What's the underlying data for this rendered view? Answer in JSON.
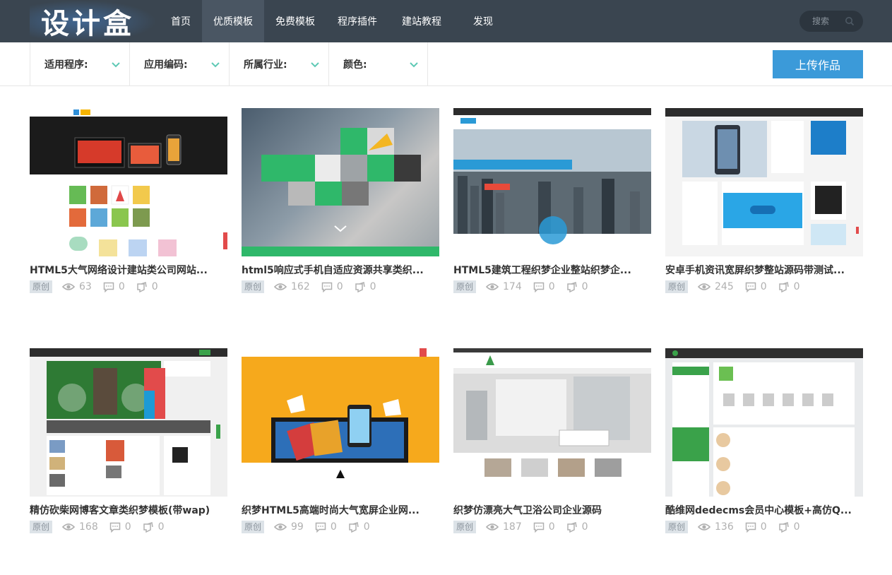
{
  "logo": {
    "text": "设计盒"
  },
  "nav": {
    "items": [
      {
        "label": "首页"
      },
      {
        "label": "优质模板"
      },
      {
        "label": "免费模板"
      },
      {
        "label": "程序插件"
      },
      {
        "label": "建站教程"
      },
      {
        "label": "发现"
      }
    ],
    "active_index": 1
  },
  "search": {
    "placeholder": "搜索",
    "icon": "search-icon"
  },
  "filters": [
    {
      "label": "适用程序:"
    },
    {
      "label": "应用编码:"
    },
    {
      "label": "所属行业:"
    },
    {
      "label": "颜色:"
    }
  ],
  "upload": {
    "label": "上传作品"
  },
  "colors": {
    "topbar": "#3a4550",
    "accent": "#3b9ad9",
    "chevron": "#5ec9b5"
  },
  "cards": [
    {
      "title": "HTML5大气网络设计建站类公司网站...",
      "badge": "原创",
      "views": "63",
      "comments": "0",
      "likes": "0"
    },
    {
      "title": "html5响应式手机自适应资源共享类织...",
      "badge": "原创",
      "views": "162",
      "comments": "0",
      "likes": "0"
    },
    {
      "title": "HTML5建筑工程织梦企业整站织梦企...",
      "badge": "原创",
      "views": "174",
      "comments": "0",
      "likes": "0"
    },
    {
      "title": "安卓手机资讯宽屏织梦整站源码带测试...",
      "badge": "原创",
      "views": "245",
      "comments": "0",
      "likes": "0"
    },
    {
      "title": "精仿砍柴网博客文章类织梦模板(带wap)",
      "badge": "原创",
      "views": "168",
      "comments": "0",
      "likes": "0"
    },
    {
      "title": "织梦HTML5高端时尚大气宽屏企业网...",
      "badge": "原创",
      "views": "99",
      "comments": "0",
      "likes": "0"
    },
    {
      "title": "织梦仿漂亮大气卫浴公司企业源码",
      "badge": "原创",
      "views": "187",
      "comments": "0",
      "likes": "0"
    },
    {
      "title": "酷维网dedecms会员中心模板+高仿Q...",
      "badge": "原创",
      "views": "136",
      "comments": "0",
      "likes": "0"
    }
  ]
}
